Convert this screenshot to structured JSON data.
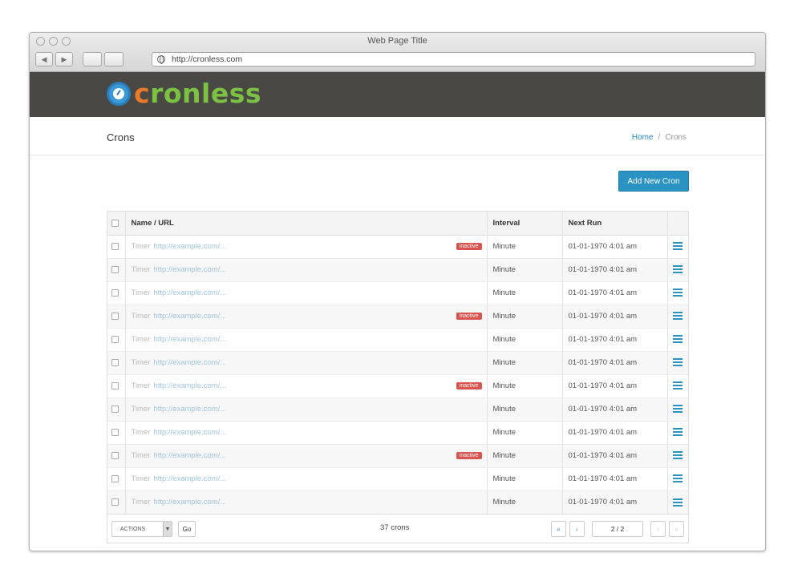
{
  "browser": {
    "window_title": "Web Page Title",
    "url": "http://cronless.com",
    "back_icon": "chevron-left-icon",
    "forward_icon": "chevron-right-icon"
  },
  "brand": {
    "logo_first": "c",
    "logo_rest": "ronless",
    "logo_orange": "#e97a2b",
    "logo_green": "#7cc242",
    "header_bg": "#4a4844"
  },
  "page": {
    "title": "Crons",
    "breadcrumb": {
      "home": "Home",
      "separator": "/",
      "current": "Crons"
    }
  },
  "add_button": "Add New Cron",
  "table": {
    "headers": {
      "name": "Name / URL",
      "interval": "Interval",
      "next_run": "Next Run"
    },
    "rows": [
      {
        "name": "Timer",
        "url": "http://example.com/...",
        "badge": "inactive",
        "interval": "Minute",
        "next_run": "01-01-1970 4:01 am"
      },
      {
        "name": "Timer",
        "url": "http://example.com/...",
        "badge": "",
        "interval": "Minute",
        "next_run": "01-01-1970 4:01 am"
      },
      {
        "name": "Timer",
        "url": "http://example.com/...",
        "badge": "",
        "interval": "Minute",
        "next_run": "01-01-1970 4:01 am"
      },
      {
        "name": "Timer",
        "url": "http://example.com/...",
        "badge": "inactive",
        "interval": "Minute",
        "next_run": "01-01-1970 4:01 am"
      },
      {
        "name": "Timer",
        "url": "http://example.com/...",
        "badge": "",
        "interval": "Minute",
        "next_run": "01-01-1970 4:01 am"
      },
      {
        "name": "Timer",
        "url": "http://example.com/...",
        "badge": "",
        "interval": "Minute",
        "next_run": "01-01-1970 4:01 am"
      },
      {
        "name": "Timer",
        "url": "http://example.com/...",
        "badge": "inactive",
        "interval": "Minute",
        "next_run": "01-01-1970 4:01 am"
      },
      {
        "name": "Timer",
        "url": "http://example.com/...",
        "badge": "",
        "interval": "Minute",
        "next_run": "01-01-1970 4:01 am"
      },
      {
        "name": "Timer",
        "url": "http://example.com/...",
        "badge": "",
        "interval": "Minute",
        "next_run": "01-01-1970 4:01 am"
      },
      {
        "name": "Timer",
        "url": "http://example.com/...",
        "badge": "inactive",
        "interval": "Minute",
        "next_run": "01-01-1970 4:01 am"
      },
      {
        "name": "Timer",
        "url": "http://example.com/...",
        "badge": "",
        "interval": "Minute",
        "next_run": "01-01-1970 4:01 am"
      },
      {
        "name": "Timer",
        "url": "http://example.com/...",
        "badge": "",
        "interval": "Minute",
        "next_run": "01-01-1970 4:01 am"
      }
    ]
  },
  "footer": {
    "actions_label": "ACTIONS",
    "go_label": "Go",
    "count": "37 crons",
    "first": "«",
    "prev": "‹",
    "page_info": "2 / 2",
    "next": "›",
    "last": "»"
  }
}
